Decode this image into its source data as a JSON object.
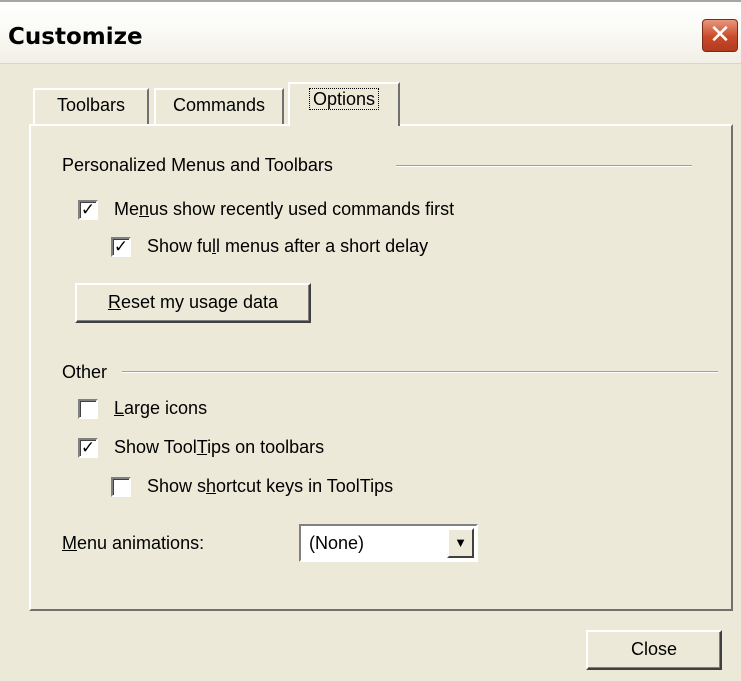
{
  "window": {
    "title": "Customize",
    "close_glyph": "✕"
  },
  "tabs": [
    {
      "label": "Toolbars"
    },
    {
      "label": "Commands"
    },
    {
      "label": "Options",
      "active": true
    }
  ],
  "group_personalized": {
    "title": "Personalized Menus and Toolbars",
    "menus_recent": {
      "label_pre": "Me",
      "label_ul": "n",
      "label_post": "us show recently used commands first",
      "checked": true
    },
    "full_menus": {
      "label_pre": "Show fu",
      "label_ul": "l",
      "label_post": "l menus after a short delay",
      "checked": true
    },
    "reset_button": {
      "label_ul": "R",
      "label_post": "eset my usage data"
    }
  },
  "group_other": {
    "title": "Other",
    "large_icons": {
      "label_ul": "L",
      "label_post": "arge icons",
      "checked": false
    },
    "tooltips": {
      "label_pre": "Show Tool",
      "label_ul": "T",
      "label_post": "ips on toolbars",
      "checked": true
    },
    "shortcut_keys": {
      "label_pre": "Show s",
      "label_ul": "h",
      "label_post": "ortcut keys in ToolTips",
      "checked": false
    }
  },
  "menu_animations": {
    "label_ul": "M",
    "label_post": "enu animations:",
    "value": "(None)",
    "arrow_glyph": "▼"
  },
  "footer": {
    "close_label": "Close"
  },
  "check_glyph": "✓",
  "colors": {
    "face": "#ece9d8",
    "close_button_red": "#c94a2a"
  }
}
